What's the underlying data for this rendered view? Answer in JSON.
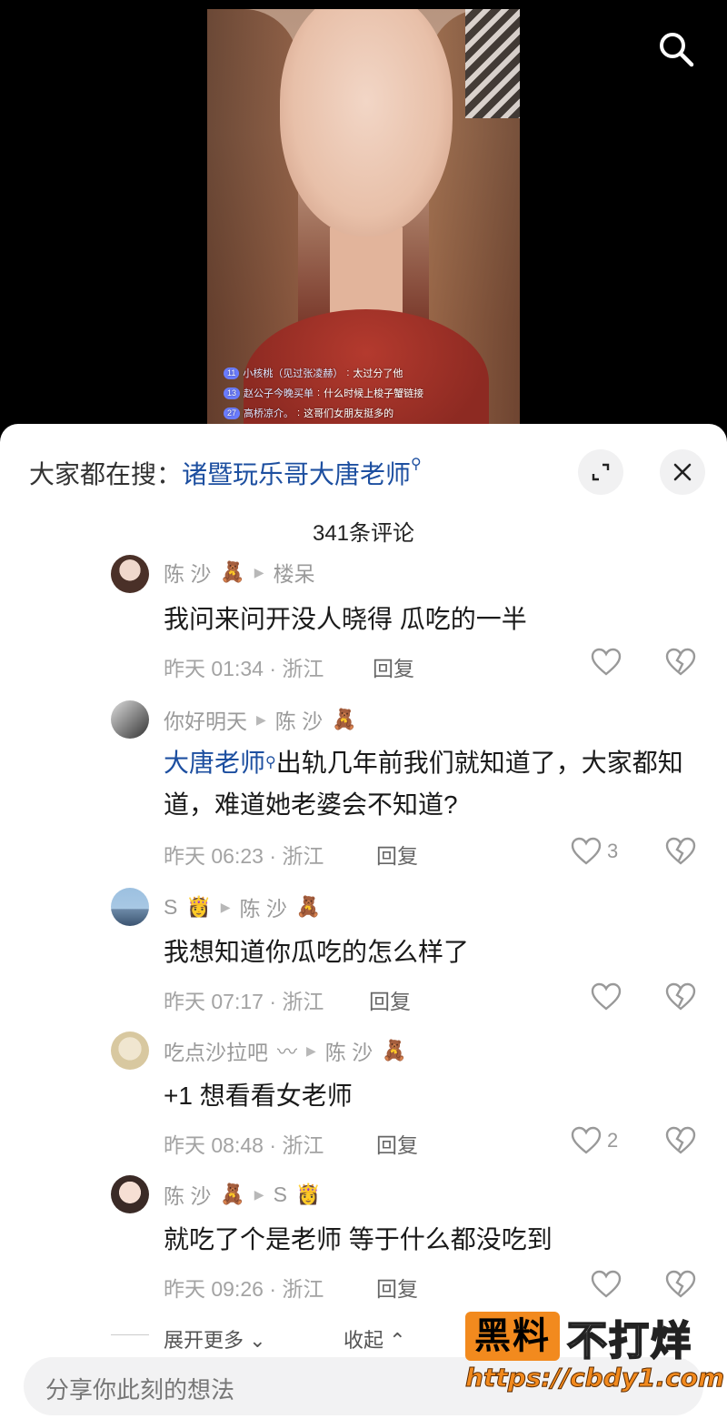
{
  "video": {
    "live_comments": [
      {
        "badge": "11",
        "user": "小核桃（见过张凌赫）",
        "text": "太过分了他"
      },
      {
        "badge": "13",
        "user": "赵公子今晚买单",
        "text": "什么时候上梭子蟹链接"
      },
      {
        "badge": "27",
        "user": "高桥凉介。",
        "text": "这哥们女朋友挺多的"
      }
    ]
  },
  "sheet": {
    "hot_search_prefix": "大家都在搜：",
    "hot_search_term": "诸暨玩乐哥大唐老师",
    "comment_count": "341条评论"
  },
  "comments": [
    {
      "user": "陈 沙",
      "user_emoji": "🧸",
      "reply_to": "楼呆",
      "reply_to_emoji": "",
      "body": "我问来问开没人晓得 瓜吃的一半",
      "time": "昨天 01:34 · 浙江",
      "reply": "回复",
      "likes": ""
    },
    {
      "user": "你好明天",
      "user_emoji": "",
      "reply_to": "陈 沙",
      "reply_to_emoji": "🧸",
      "body_link": "大唐老师",
      "body": "出轨几年前我们就知道了，大家都知道，难道她老婆会不知道?",
      "time": "昨天 06:23 · 浙江",
      "reply": "回复",
      "likes": "3"
    },
    {
      "user": "S",
      "user_emoji": "👸",
      "reply_to": "陈 沙",
      "reply_to_emoji": "🧸",
      "body": "我想知道你瓜吃的怎么样了",
      "time": "昨天 07:17 · 浙江",
      "reply": "回复",
      "likes": ""
    },
    {
      "user": "吃点沙拉吧",
      "user_emoji": "〰",
      "reply_to": "陈 沙",
      "reply_to_emoji": "🧸",
      "body": "+1 想看看女老师",
      "time": "昨天 08:48 · 浙江",
      "reply": "回复",
      "likes": "2"
    },
    {
      "user": "陈 沙",
      "user_emoji": "🧸",
      "reply_to": "S",
      "reply_to_emoji": "👸",
      "body": "就吃了个是老师 等于什么都没吃到",
      "time": "昨天 09:26 · 浙江",
      "reply": "回复",
      "likes": ""
    }
  ],
  "footer": {
    "expand_more": "展开更多",
    "collapse": "收起",
    "input_placeholder": "分享你此刻的想法"
  },
  "watermark": {
    "box_text": "黑料",
    "side_text": "不打烊",
    "url": "https://cbdy1.com"
  },
  "colors": {
    "link": "#1d4fa0",
    "watermark_orange": "#f28a1e",
    "sheet_bg": "#ffffff"
  }
}
